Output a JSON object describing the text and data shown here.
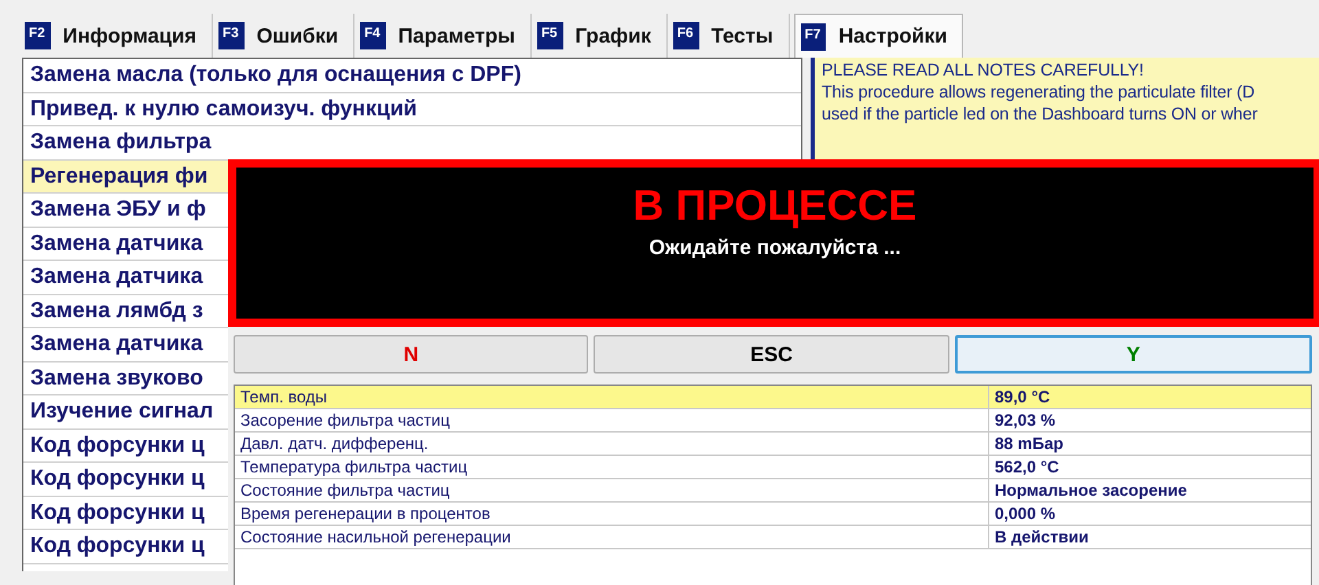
{
  "tabs": [
    {
      "key": "F2",
      "label": "Информация",
      "selected": false
    },
    {
      "key": "F3",
      "label": "Ошибки",
      "selected": false
    },
    {
      "key": "F4",
      "label": "Параметры",
      "selected": false
    },
    {
      "key": "F5",
      "label": "График",
      "selected": false
    },
    {
      "key": "F6",
      "label": "Тесты",
      "selected": false
    },
    {
      "key": "F7",
      "label": "Настройки",
      "selected": true
    }
  ],
  "procedures": [
    {
      "label": "Замена масла (только для оснащения с DPF)",
      "selected": false
    },
    {
      "label": "Привед. к нулю самоизуч. функций",
      "selected": false
    },
    {
      "label": "Замена фильтра",
      "selected": false
    },
    {
      "label": "Регенерация фи",
      "selected": true
    },
    {
      "label": "Замена ЭБУ и ф",
      "selected": false
    },
    {
      "label": "Замена датчика",
      "selected": false
    },
    {
      "label": "Замена датчика",
      "selected": false
    },
    {
      "label": "Замена лямбд з",
      "selected": false
    },
    {
      "label": "Замена датчика",
      "selected": false
    },
    {
      "label": "Замена звуково",
      "selected": false
    },
    {
      "label": "Изучение сигнал",
      "selected": false
    },
    {
      "label": "Код форсунки ц",
      "selected": false
    },
    {
      "label": "Код форсунки ц",
      "selected": false
    },
    {
      "label": "Код форсунки ц",
      "selected": false
    },
    {
      "label": "Код форсунки ц",
      "selected": false
    }
  ],
  "notes": [
    "PLEASE READ ALL NOTES CAREFULLY!",
    "This procedure allows regenerating the particulate filter (D",
    "used if the particle led on the Dashboard turns ON or wher"
  ],
  "dialog": {
    "title": "В ПРОЦЕССЕ",
    "message": "Ожидайте пожалуйста ...",
    "buttons": [
      {
        "label": "N",
        "color": "#e00000",
        "focused": false
      },
      {
        "label": "ESC",
        "color": "#000000",
        "focused": false
      },
      {
        "label": "Y",
        "color": "#008000",
        "focused": true
      }
    ],
    "parameters": [
      {
        "name": "Темп. воды",
        "value": "89,0 °C",
        "selected": true
      },
      {
        "name": "Засорение фильтра частиц",
        "value": "92,03 %",
        "selected": false
      },
      {
        "name": "Давл. датч. дифференц.",
        "value": "88 mБар",
        "selected": false
      },
      {
        "name": "Температура фильтра частиц",
        "value": "562,0 °C",
        "selected": false
      },
      {
        "name": "Состояние фильтра частиц",
        "value": "Нормальное засорение",
        "selected": false
      },
      {
        "name": "Время регенерации в процентов",
        "value": "0,000 %",
        "selected": false
      },
      {
        "name": "Состояние насильной регенерации",
        "value": "В действии",
        "selected": false
      }
    ]
  }
}
